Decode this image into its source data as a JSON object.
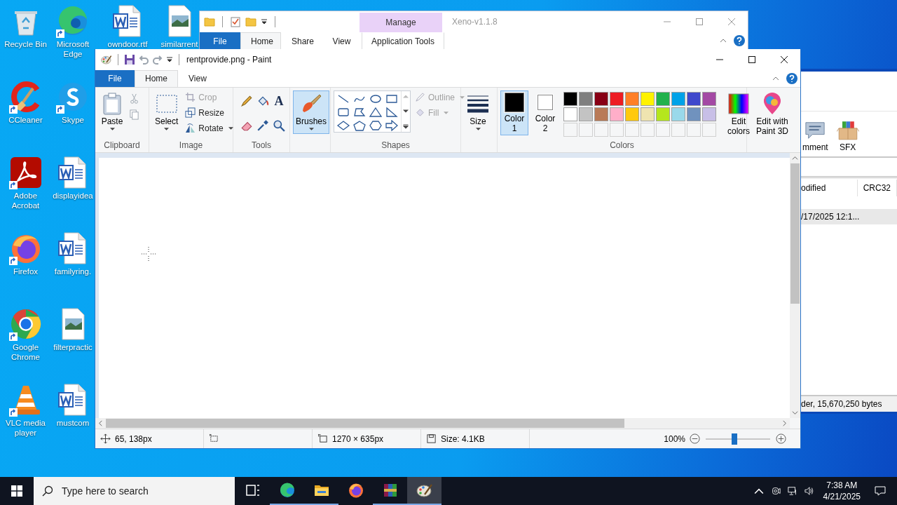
{
  "desktop_icons": [
    {
      "label": "Recycle Bin",
      "kind": "recycle",
      "shortcut": false
    },
    {
      "label": "CCleaner",
      "kind": "ccleaner",
      "shortcut": true
    },
    {
      "label": "Adobe Acrobat",
      "kind": "acrobat",
      "shortcut": true
    },
    {
      "label": "Firefox",
      "kind": "firefox",
      "shortcut": true
    },
    {
      "label": "Google Chrome",
      "kind": "chrome",
      "shortcut": true
    },
    {
      "label": "VLC media player",
      "kind": "vlc",
      "shortcut": true
    },
    {
      "label": "Microsoft Edge",
      "kind": "edge",
      "shortcut": true
    },
    {
      "label": "Skype",
      "kind": "skype",
      "shortcut": true
    },
    {
      "label": "displayidea",
      "kind": "word",
      "shortcut": false
    },
    {
      "label": "familyring.",
      "kind": "word",
      "shortcut": false
    },
    {
      "label": "filterpractic",
      "kind": "image",
      "shortcut": false
    },
    {
      "label": "mustcom",
      "kind": "word",
      "shortcut": false
    },
    {
      "label": "owndoor.rtf",
      "kind": "word",
      "shortcut": false
    },
    {
      "label": "similarrent",
      "kind": "image",
      "shortcut": false
    }
  ],
  "explorer_window": {
    "title": "Xeno-v1.1.8",
    "context_group": "Manage",
    "tabs": [
      {
        "label": "File",
        "kind": "file",
        "selected": false
      },
      {
        "label": "Home",
        "kind": "tab",
        "selected": true
      },
      {
        "label": "Share",
        "kind": "tab",
        "selected": false
      },
      {
        "label": "View",
        "kind": "tab",
        "selected": false
      },
      {
        "label": "Application Tools",
        "kind": "context",
        "selected": false
      }
    ]
  },
  "archive_window": {
    "toolbar": [
      {
        "label": "mment",
        "kind": "comment"
      },
      {
        "label": "SFX",
        "kind": "sfx"
      }
    ],
    "columns": [
      "odified",
      "CRC32"
    ],
    "rows": [
      {
        "cells": [
          "/17/2025 12:1..."
        ],
        "selected": true
      }
    ],
    "status": "der, 15,670,250 bytes"
  },
  "paint_window": {
    "title": "rentprovide.png - Paint",
    "tabs": [
      {
        "label": "File",
        "kind": "file",
        "selected": false
      },
      {
        "label": "Home",
        "kind": "tab",
        "selected": true
      },
      {
        "label": "View",
        "kind": "tab",
        "selected": false
      }
    ],
    "ribbon": {
      "clipboard": {
        "label": "Clipboard",
        "paste": "Paste"
      },
      "image": {
        "label": "Image",
        "select": "Select",
        "crop": {
          "label": "Crop",
          "disabled": true
        },
        "resize": {
          "label": "Resize",
          "disabled": false
        },
        "rotate": {
          "label": "Rotate",
          "disabled": false
        }
      },
      "tools": {
        "label": "Tools",
        "text_tool": "A"
      },
      "brushes": {
        "label": "Brushes",
        "selected": true
      },
      "shapes": {
        "label": "Shapes",
        "outline": {
          "label": "Outline",
          "disabled": true
        },
        "fill": {
          "label": "Fill",
          "disabled": true
        }
      },
      "size": {
        "label": "Size"
      },
      "colors": {
        "label": "Colors",
        "color1": {
          "label": "Color 1",
          "color": "#000000",
          "selected": true
        },
        "color2": {
          "label": "Color 2",
          "color": "#ffffff",
          "selected": false
        },
        "palette": [
          {
            "kind": "color",
            "color": "#000000"
          },
          {
            "kind": "color",
            "color": "#7f7f7f"
          },
          {
            "kind": "color",
            "color": "#880015"
          },
          {
            "kind": "color",
            "color": "#ed1c24"
          },
          {
            "kind": "color",
            "color": "#ff7f27"
          },
          {
            "kind": "color",
            "color": "#fff200"
          },
          {
            "kind": "color",
            "color": "#22b14c"
          },
          {
            "kind": "color",
            "color": "#00a2e8"
          },
          {
            "kind": "color",
            "color": "#3f48cc"
          },
          {
            "kind": "color",
            "color": "#a349a4"
          },
          {
            "kind": "color",
            "color": "#ffffff"
          },
          {
            "kind": "color",
            "color": "#c3c3c3"
          },
          {
            "kind": "color",
            "color": "#b97a57"
          },
          {
            "kind": "color",
            "color": "#ffaec9"
          },
          {
            "kind": "color",
            "color": "#ffc90e"
          },
          {
            "kind": "color",
            "color": "#efe4b0"
          },
          {
            "kind": "color",
            "color": "#b5e61d"
          },
          {
            "kind": "color",
            "color": "#99d9ea"
          },
          {
            "kind": "color",
            "color": "#7092be"
          },
          {
            "kind": "color",
            "color": "#c8bfe7"
          },
          {
            "kind": "empty"
          },
          {
            "kind": "empty"
          },
          {
            "kind": "empty"
          },
          {
            "kind": "empty"
          },
          {
            "kind": "empty"
          },
          {
            "kind": "empty"
          },
          {
            "kind": "empty"
          },
          {
            "kind": "empty"
          },
          {
            "kind": "empty"
          },
          {
            "kind": "empty"
          }
        ],
        "edit_colors": "Edit colors"
      },
      "paint3d": {
        "label": "Edit with Paint 3D"
      }
    },
    "status_bar": {
      "cursor_position": "65, 138px",
      "image_dimensions": "1270 × 635px",
      "file_size": "Size: 4.1KB",
      "zoom": "100%",
      "zoom_slider": {
        "level": 0.45
      }
    }
  },
  "taskbar": {
    "search": {
      "placeholder": "Type here to search"
    },
    "apps": [
      {
        "kind": "taskview",
        "running": false,
        "selected": false
      },
      {
        "kind": "edge",
        "running": true,
        "selected": false
      },
      {
        "kind": "folder",
        "running": true,
        "selected": false
      },
      {
        "kind": "firefox",
        "running": false,
        "selected": false
      },
      {
        "kind": "winrar",
        "running": true,
        "selected": false
      },
      {
        "kind": "paint",
        "running": true,
        "selected": true
      }
    ],
    "time": "7:38 AM",
    "date": "4/21/2025"
  }
}
